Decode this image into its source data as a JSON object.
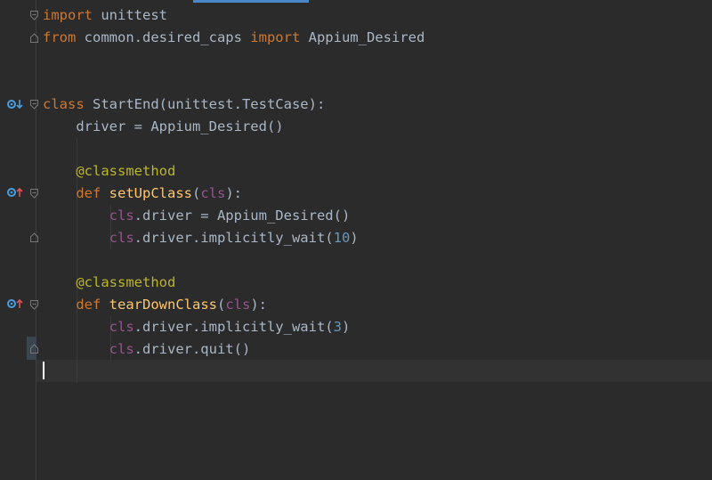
{
  "editor": {
    "lines": [
      [
        {
          "t": "import",
          "c": "kw"
        },
        {
          "t": " unittest",
          "c": "id"
        }
      ],
      [
        {
          "t": "from",
          "c": "kw"
        },
        {
          "t": " common.desired_caps ",
          "c": "id"
        },
        {
          "t": "import",
          "c": "kw"
        },
        {
          "t": " Appium_Desired",
          "c": "id"
        }
      ],
      [],
      [],
      [
        {
          "t": "class",
          "c": "kw"
        },
        {
          "t": " StartEnd(unittest.TestCase):",
          "c": "id"
        }
      ],
      [
        {
          "t": "    driver = Appium_Desired()",
          "c": "id"
        }
      ],
      [],
      [
        {
          "t": "    ",
          "c": "id"
        },
        {
          "t": "@classmethod",
          "c": "dec"
        }
      ],
      [
        {
          "t": "    ",
          "c": "id"
        },
        {
          "t": "def",
          "c": "kw"
        },
        {
          "t": " ",
          "c": "id"
        },
        {
          "t": "setUpClass",
          "c": "fn"
        },
        {
          "t": "(",
          "c": "id"
        },
        {
          "t": "cls",
          "c": "self"
        },
        {
          "t": "):",
          "c": "id"
        }
      ],
      [
        {
          "t": "        ",
          "c": "id"
        },
        {
          "t": "cls",
          "c": "self"
        },
        {
          "t": ".driver = Appium_Desired()",
          "c": "id"
        }
      ],
      [
        {
          "t": "        ",
          "c": "id"
        },
        {
          "t": "cls",
          "c": "self"
        },
        {
          "t": ".driver.implicitly_wait(",
          "c": "id"
        },
        {
          "t": "10",
          "c": "num"
        },
        {
          "t": ")",
          "c": "id"
        }
      ],
      [],
      [
        {
          "t": "    ",
          "c": "id"
        },
        {
          "t": "@classmethod",
          "c": "dec"
        }
      ],
      [
        {
          "t": "    ",
          "c": "id"
        },
        {
          "t": "def",
          "c": "kw"
        },
        {
          "t": " ",
          "c": "id"
        },
        {
          "t": "tearDownClass",
          "c": "fn"
        },
        {
          "t": "(",
          "c": "id"
        },
        {
          "t": "cls",
          "c": "self"
        },
        {
          "t": "):",
          "c": "id"
        }
      ],
      [
        {
          "t": "        ",
          "c": "id"
        },
        {
          "t": "cls",
          "c": "self"
        },
        {
          "t": ".driver.implicitly_wait(",
          "c": "id"
        },
        {
          "t": "3",
          "c": "num"
        },
        {
          "t": ")",
          "c": "id"
        }
      ],
      [
        {
          "t": "        ",
          "c": "id"
        },
        {
          "t": "cls",
          "c": "self"
        },
        {
          "t": ".driver.quit()",
          "c": "id"
        }
      ],
      []
    ]
  },
  "colors": {
    "keyword": "#cc7832",
    "identifier": "#a9b7c6",
    "decorator": "#bbb529",
    "function": "#ffc66d",
    "self": "#94558d",
    "number": "#6897bb",
    "background": "#2b2b2b"
  },
  "gutter_icons": [
    "implemented-icon",
    "override-icon",
    "override-icon"
  ]
}
